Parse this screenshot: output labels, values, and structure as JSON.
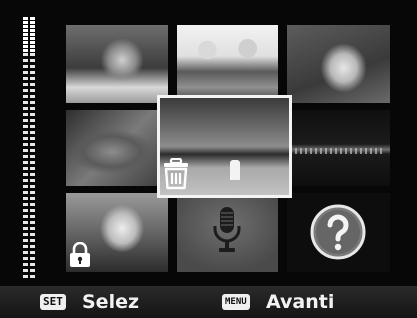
{
  "playback": {
    "thumbnails": [
      {
        "id": "thumb-1",
        "content": "couple-outdoors"
      },
      {
        "id": "thumb-2",
        "content": "children"
      },
      {
        "id": "thumb-3",
        "content": "child-portrait"
      },
      {
        "id": "thumb-4",
        "content": "leaf"
      },
      {
        "id": "thumb-6",
        "content": "city-night"
      },
      {
        "id": "thumb-7",
        "content": "woman-portrait"
      },
      {
        "id": "thumb-8",
        "content": "voice-memo"
      },
      {
        "id": "thumb-9",
        "content": "unknown-file"
      }
    ],
    "selected": {
      "id": "thumb-5",
      "content": "beach-landscape",
      "status_icon": "trash-icon"
    }
  },
  "icons": {
    "delete": "trash-icon",
    "protect": "lock-icon",
    "voice": "microphone-icon",
    "unknown": "question-icon"
  },
  "bottom_bar": {
    "select_key": "SET",
    "select_label": "Selez",
    "menu_key": "MENU",
    "next_label": "Avanti"
  },
  "colors": {
    "background": "#070707",
    "selection_border": "#f4f4f4",
    "text": "#f2f2f2"
  }
}
